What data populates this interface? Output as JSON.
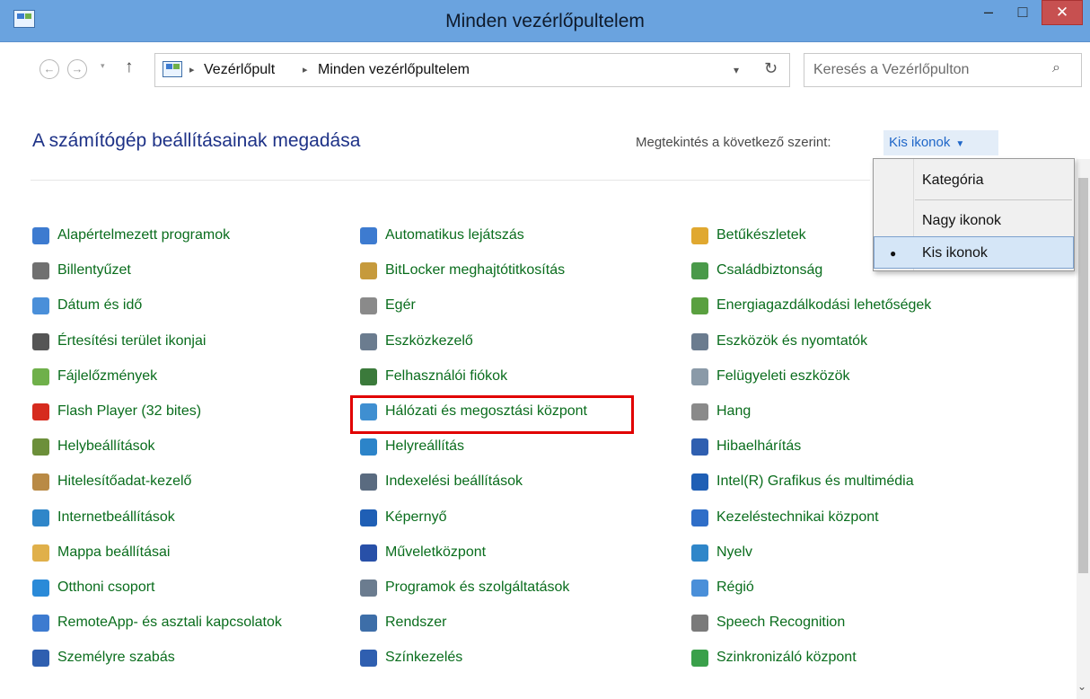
{
  "window": {
    "title": "Minden vezérlőpultelem",
    "minimize": "–",
    "maximize": "□",
    "close": "✕"
  },
  "nav": {
    "back": "←",
    "forward": "→",
    "up": "↑",
    "dropdown": "▾"
  },
  "address": {
    "crumbs": [
      "Vezérlőpult",
      "Minden vezérlőpultelem"
    ],
    "separator": "▸",
    "chevron": "▾",
    "refresh": "↻"
  },
  "search": {
    "placeholder": "Keresés a Vezérlőpulton",
    "icon": "⌕"
  },
  "heading": {
    "title": "A számítógép beállításainak megadása",
    "view_label": "Megtekintés a következő szerint:",
    "view_value": "Kis ikonok",
    "caret": "▼"
  },
  "view_menu": {
    "bullet": "●",
    "options": [
      "Kategória",
      "Nagy ikonok",
      "Kis ikonok"
    ],
    "selected": "Kis ikonok"
  },
  "items": [
    {
      "label": "Alapértelmezett programok",
      "icon": "default-programs-icon",
      "color": "#3d7bd0"
    },
    {
      "label": "Billentyűzet",
      "icon": "keyboard-icon",
      "color": "#707070"
    },
    {
      "label": "Dátum és idő",
      "icon": "date-time-icon",
      "color": "#4a8fd9"
    },
    {
      "label": "Értesítési terület ikonjai",
      "icon": "notification-area-icon",
      "color": "#555555"
    },
    {
      "label": "Fájlelőzmények",
      "icon": "file-history-icon",
      "color": "#6fb04a"
    },
    {
      "label": "Flash Player (32 bites)",
      "icon": "flash-player-icon",
      "color": "#d62b1e"
    },
    {
      "label": "Helybeállítások",
      "icon": "location-settings-icon",
      "color": "#6c8f3a"
    },
    {
      "label": "Hitelesítőadat-kezelő",
      "icon": "credential-manager-icon",
      "color": "#b98a45"
    },
    {
      "label": "Internetbeállítások",
      "icon": "internet-options-icon",
      "color": "#2f86c9"
    },
    {
      "label": "Mappa beállításai",
      "icon": "folder-options-icon",
      "color": "#e0b04a"
    },
    {
      "label": "Otthoni csoport",
      "icon": "homegroup-icon",
      "color": "#2a8ad8"
    },
    {
      "label": "RemoteApp- és asztali kapcsolatok",
      "icon": "remoteapp-icon",
      "color": "#3d7bd0"
    },
    {
      "label": "Személyre szabás",
      "icon": "personalization-icon",
      "color": "#2f5fb0"
    },
    {
      "label": "Automatikus lejátszás",
      "icon": "autoplay-icon",
      "color": "#3d7bd0"
    },
    {
      "label": "BitLocker meghajtótitkosítás",
      "icon": "bitlocker-icon",
      "color": "#c69a3c"
    },
    {
      "label": "Egér",
      "icon": "mouse-icon",
      "color": "#8a8a8a"
    },
    {
      "label": "Eszközkezelő",
      "icon": "device-manager-icon",
      "color": "#6b7c8f"
    },
    {
      "label": "Felhasználói fiókok",
      "icon": "user-accounts-icon",
      "color": "#3b7a3b"
    },
    {
      "label": "Hálózati és megosztási központ",
      "icon": "network-sharing-icon",
      "color": "#3f8fd1"
    },
    {
      "label": "Helyreállítás",
      "icon": "recovery-icon",
      "color": "#2c84c9"
    },
    {
      "label": "Indexelési beállítások",
      "icon": "indexing-options-icon",
      "color": "#5a6b80"
    },
    {
      "label": "Képernyő",
      "icon": "display-icon",
      "color": "#1f5fb5"
    },
    {
      "label": "Műveletközpont",
      "icon": "action-center-icon",
      "color": "#2850a8"
    },
    {
      "label": "Programok és szolgáltatások",
      "icon": "programs-features-icon",
      "color": "#6b7c8f"
    },
    {
      "label": "Rendszer",
      "icon": "system-icon",
      "color": "#3d6ea8"
    },
    {
      "label": "Színkezelés",
      "icon": "color-management-icon",
      "color": "#2f5fb0"
    },
    {
      "label": "Betűkészletek",
      "icon": "fonts-icon",
      "color": "#e0a830"
    },
    {
      "label": "Családbiztonság",
      "icon": "family-safety-icon",
      "color": "#4a9a4a"
    },
    {
      "label": "Energiagazdálkodási lehetőségek",
      "icon": "power-options-icon",
      "color": "#5aa040"
    },
    {
      "label": "Eszközök és nyomtatók",
      "icon": "devices-printers-icon",
      "color": "#6b7c8f"
    },
    {
      "label": "Felügyeleti eszközök",
      "icon": "administrative-tools-icon",
      "color": "#8a9aa8"
    },
    {
      "label": "Hang",
      "icon": "sound-icon",
      "color": "#8a8a8a"
    },
    {
      "label": "Hibaelhárítás",
      "icon": "troubleshooting-icon",
      "color": "#2f5fb0"
    },
    {
      "label": "Intel(R) Grafikus és multimédia",
      "icon": "intel-graphics-icon",
      "color": "#1f5fb5"
    },
    {
      "label": "Kezeléstechnikai központ",
      "icon": "ease-of-access-icon",
      "color": "#2f6ec8"
    },
    {
      "label": "Nyelv",
      "icon": "language-icon",
      "color": "#2f86c9"
    },
    {
      "label": "Régió",
      "icon": "region-icon",
      "color": "#4a8fd9"
    },
    {
      "label": "Speech Recognition",
      "icon": "speech-recognition-icon",
      "color": "#7a7a7a"
    },
    {
      "label": "Szinkronizáló központ",
      "icon": "sync-center-icon",
      "color": "#3aa04a"
    }
  ],
  "scrollbar": {
    "down_arrow": "⌄"
  }
}
